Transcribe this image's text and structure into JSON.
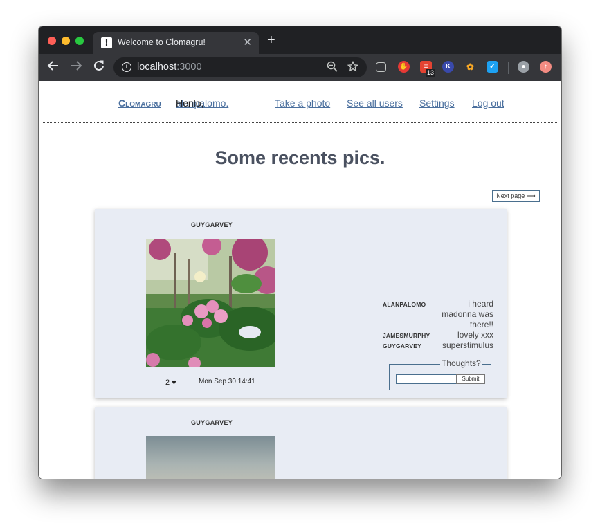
{
  "browser": {
    "tab_title": "Welcome to Clomagru!",
    "tab_favicon": "!",
    "url_host": "localhost",
    "url_port": ":3000",
    "extension_badge": "13"
  },
  "nav": {
    "brand": "Clomagru",
    "greeting_prefix": "Henlo, ",
    "username": "alanpalomo.",
    "take_photo": "Take a photo",
    "see_users": "See all users",
    "settings": "Settings",
    "logout": "Log out"
  },
  "page": {
    "heading": "Some recents pics.",
    "next_page": "Next page ⟶"
  },
  "posts": [
    {
      "user": "GUYGARVEY",
      "likes": "2 ♥",
      "date": "Mon Sep 30 14:41",
      "comments": [
        {
          "user": "ALANPALOMO",
          "text": "i heard madonna was there!!"
        },
        {
          "user": "JAMESMURPHY",
          "text": "lovely xxx"
        },
        {
          "user": "GUYGARVEY",
          "text": "superstimulus"
        }
      ],
      "comment_form": {
        "legend": "Thoughts?",
        "input_value": "",
        "submit": "Submit"
      }
    },
    {
      "user": "GUYGARVEY"
    }
  ],
  "colors": {
    "link": "#4a6f9e",
    "card_bg": "#e8ecf4",
    "heading": "#4a5160"
  }
}
